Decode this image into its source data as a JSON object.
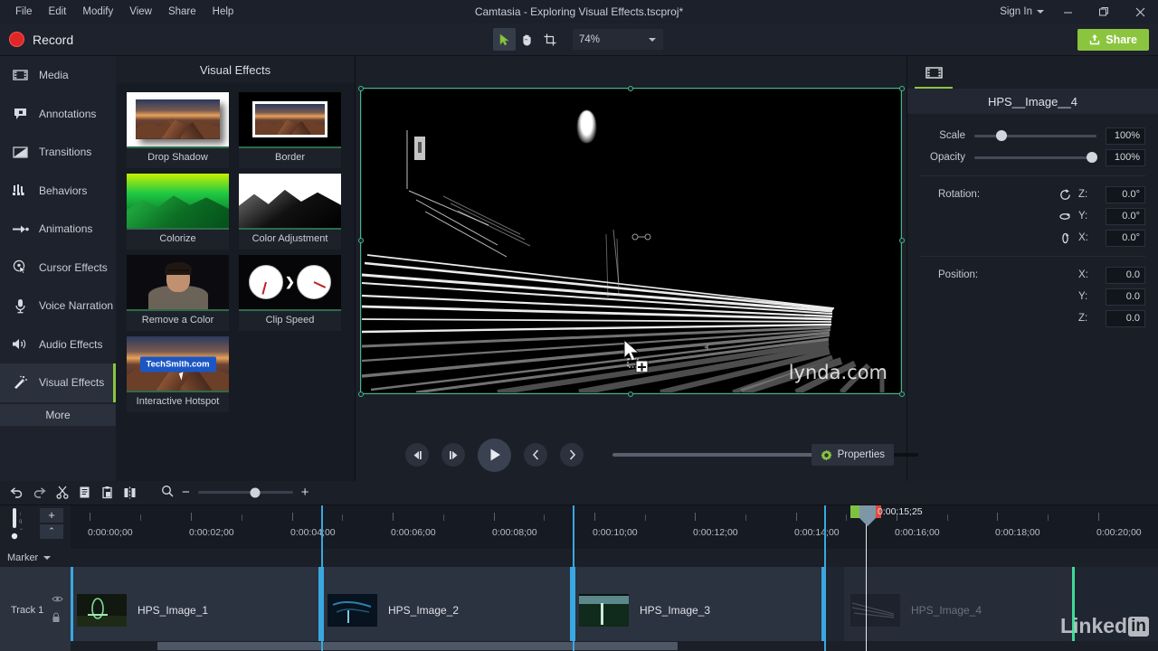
{
  "window": {
    "title": "Camtasia - Exploring Visual Effects.tscproj*",
    "sign_in": "Sign In",
    "minimize": "—",
    "maximize": "❐",
    "close": "✕"
  },
  "menu": [
    "File",
    "Edit",
    "Modify",
    "View",
    "Share",
    "Help"
  ],
  "toolbar": {
    "record_label": "Record",
    "zoom_level": "74%",
    "share_label": "Share",
    "tools": [
      "cursor-tool",
      "hand-tool",
      "crop-tool"
    ],
    "active_tool": "cursor-tool"
  },
  "sidebar": {
    "items": [
      {
        "label": "Media",
        "icon": "film-icon"
      },
      {
        "label": "Annotations",
        "icon": "callout-icon"
      },
      {
        "label": "Transitions",
        "icon": "transition-icon"
      },
      {
        "label": "Behaviors",
        "icon": "behaviors-icon"
      },
      {
        "label": "Animations",
        "icon": "arrow-icon"
      },
      {
        "label": "Cursor Effects",
        "icon": "cursor-effects-icon"
      },
      {
        "label": "Voice Narration",
        "icon": "microphone-icon"
      },
      {
        "label": "Audio Effects",
        "icon": "speaker-icon"
      },
      {
        "label": "Visual Effects",
        "icon": "magic-wand-icon"
      }
    ],
    "active": "Visual Effects",
    "more_label": "More"
  },
  "effects_panel": {
    "title": "Visual Effects",
    "items": [
      {
        "label": "Drop Shadow",
        "thumb": "drop-shadow-thumb"
      },
      {
        "label": "Border",
        "thumb": "border-thumb"
      },
      {
        "label": "Colorize",
        "thumb": "colorize-thumb"
      },
      {
        "label": "Color Adjustment",
        "thumb": "color-adjustment-thumb"
      },
      {
        "label": "Remove a Color",
        "thumb": "remove-color-thumb"
      },
      {
        "label": "Clip Speed",
        "thumb": "clip-speed-thumb"
      },
      {
        "label": "Interactive Hotspot",
        "thumb": "hotspot-thumb"
      }
    ],
    "hotspot_button_text": "TechSmith.com"
  },
  "canvas": {
    "watermark": "lynda.com",
    "selection_color": "#3fb984"
  },
  "transport": {
    "prev_frame": "prev-frame-button",
    "next_frame": "next-frame-button",
    "play": "play-button",
    "prev_clip": "previous-clip-button",
    "next_clip": "next-clip-button",
    "properties_label": "Properties"
  },
  "properties": {
    "clip_name": "HPS__Image__4",
    "scale_label": "Scale",
    "scale_value": "100%",
    "opacity_label": "Opacity",
    "opacity_value": "100%",
    "rotation_label": "Rotation:",
    "rotation": [
      {
        "axis": "Z:",
        "value": "0.0°",
        "icon": "rotate-z-icon"
      },
      {
        "axis": "Y:",
        "value": "0.0°",
        "icon": "rotate-y-icon"
      },
      {
        "axis": "X:",
        "value": "0.0°",
        "icon": "rotate-x-icon"
      }
    ],
    "position_label": "Position:",
    "position": [
      {
        "axis": "X:",
        "value": "0.0"
      },
      {
        "axis": "Y:",
        "value": "0.0"
      },
      {
        "axis": "Z:",
        "value": "0.0"
      }
    ]
  },
  "timeline": {
    "tools": [
      "undo-icon",
      "redo-icon",
      "cut-icon",
      "copy-icon",
      "paste-icon",
      "split-icon"
    ],
    "zoom_out": "−",
    "zoom_in": "+",
    "add_track_label": "+",
    "collapse_label": "⌃",
    "marker_label": "Marker",
    "track_label": "Track 1",
    "playhead_time": "0:00:15;25",
    "ruler_labels": [
      "0:00:00;00",
      "0:00:02;00",
      "0:00:04;00",
      "0:00:06;00",
      "0:00:08;00",
      "0:00:10;00",
      "0:00:12;00",
      "0:00:14;00",
      "0:00:16;00",
      "0:00:18;00",
      "0:00:20;00"
    ],
    "clips": [
      {
        "name": "HPS_Image_1",
        "faded": false
      },
      {
        "name": "HPS_Image_2",
        "faded": false
      },
      {
        "name": "HPS_Image_3",
        "faded": false
      },
      {
        "name": "HPS_Image_4",
        "faded": true
      }
    ],
    "watermark": "Linked",
    "watermark_badge": "in"
  }
}
